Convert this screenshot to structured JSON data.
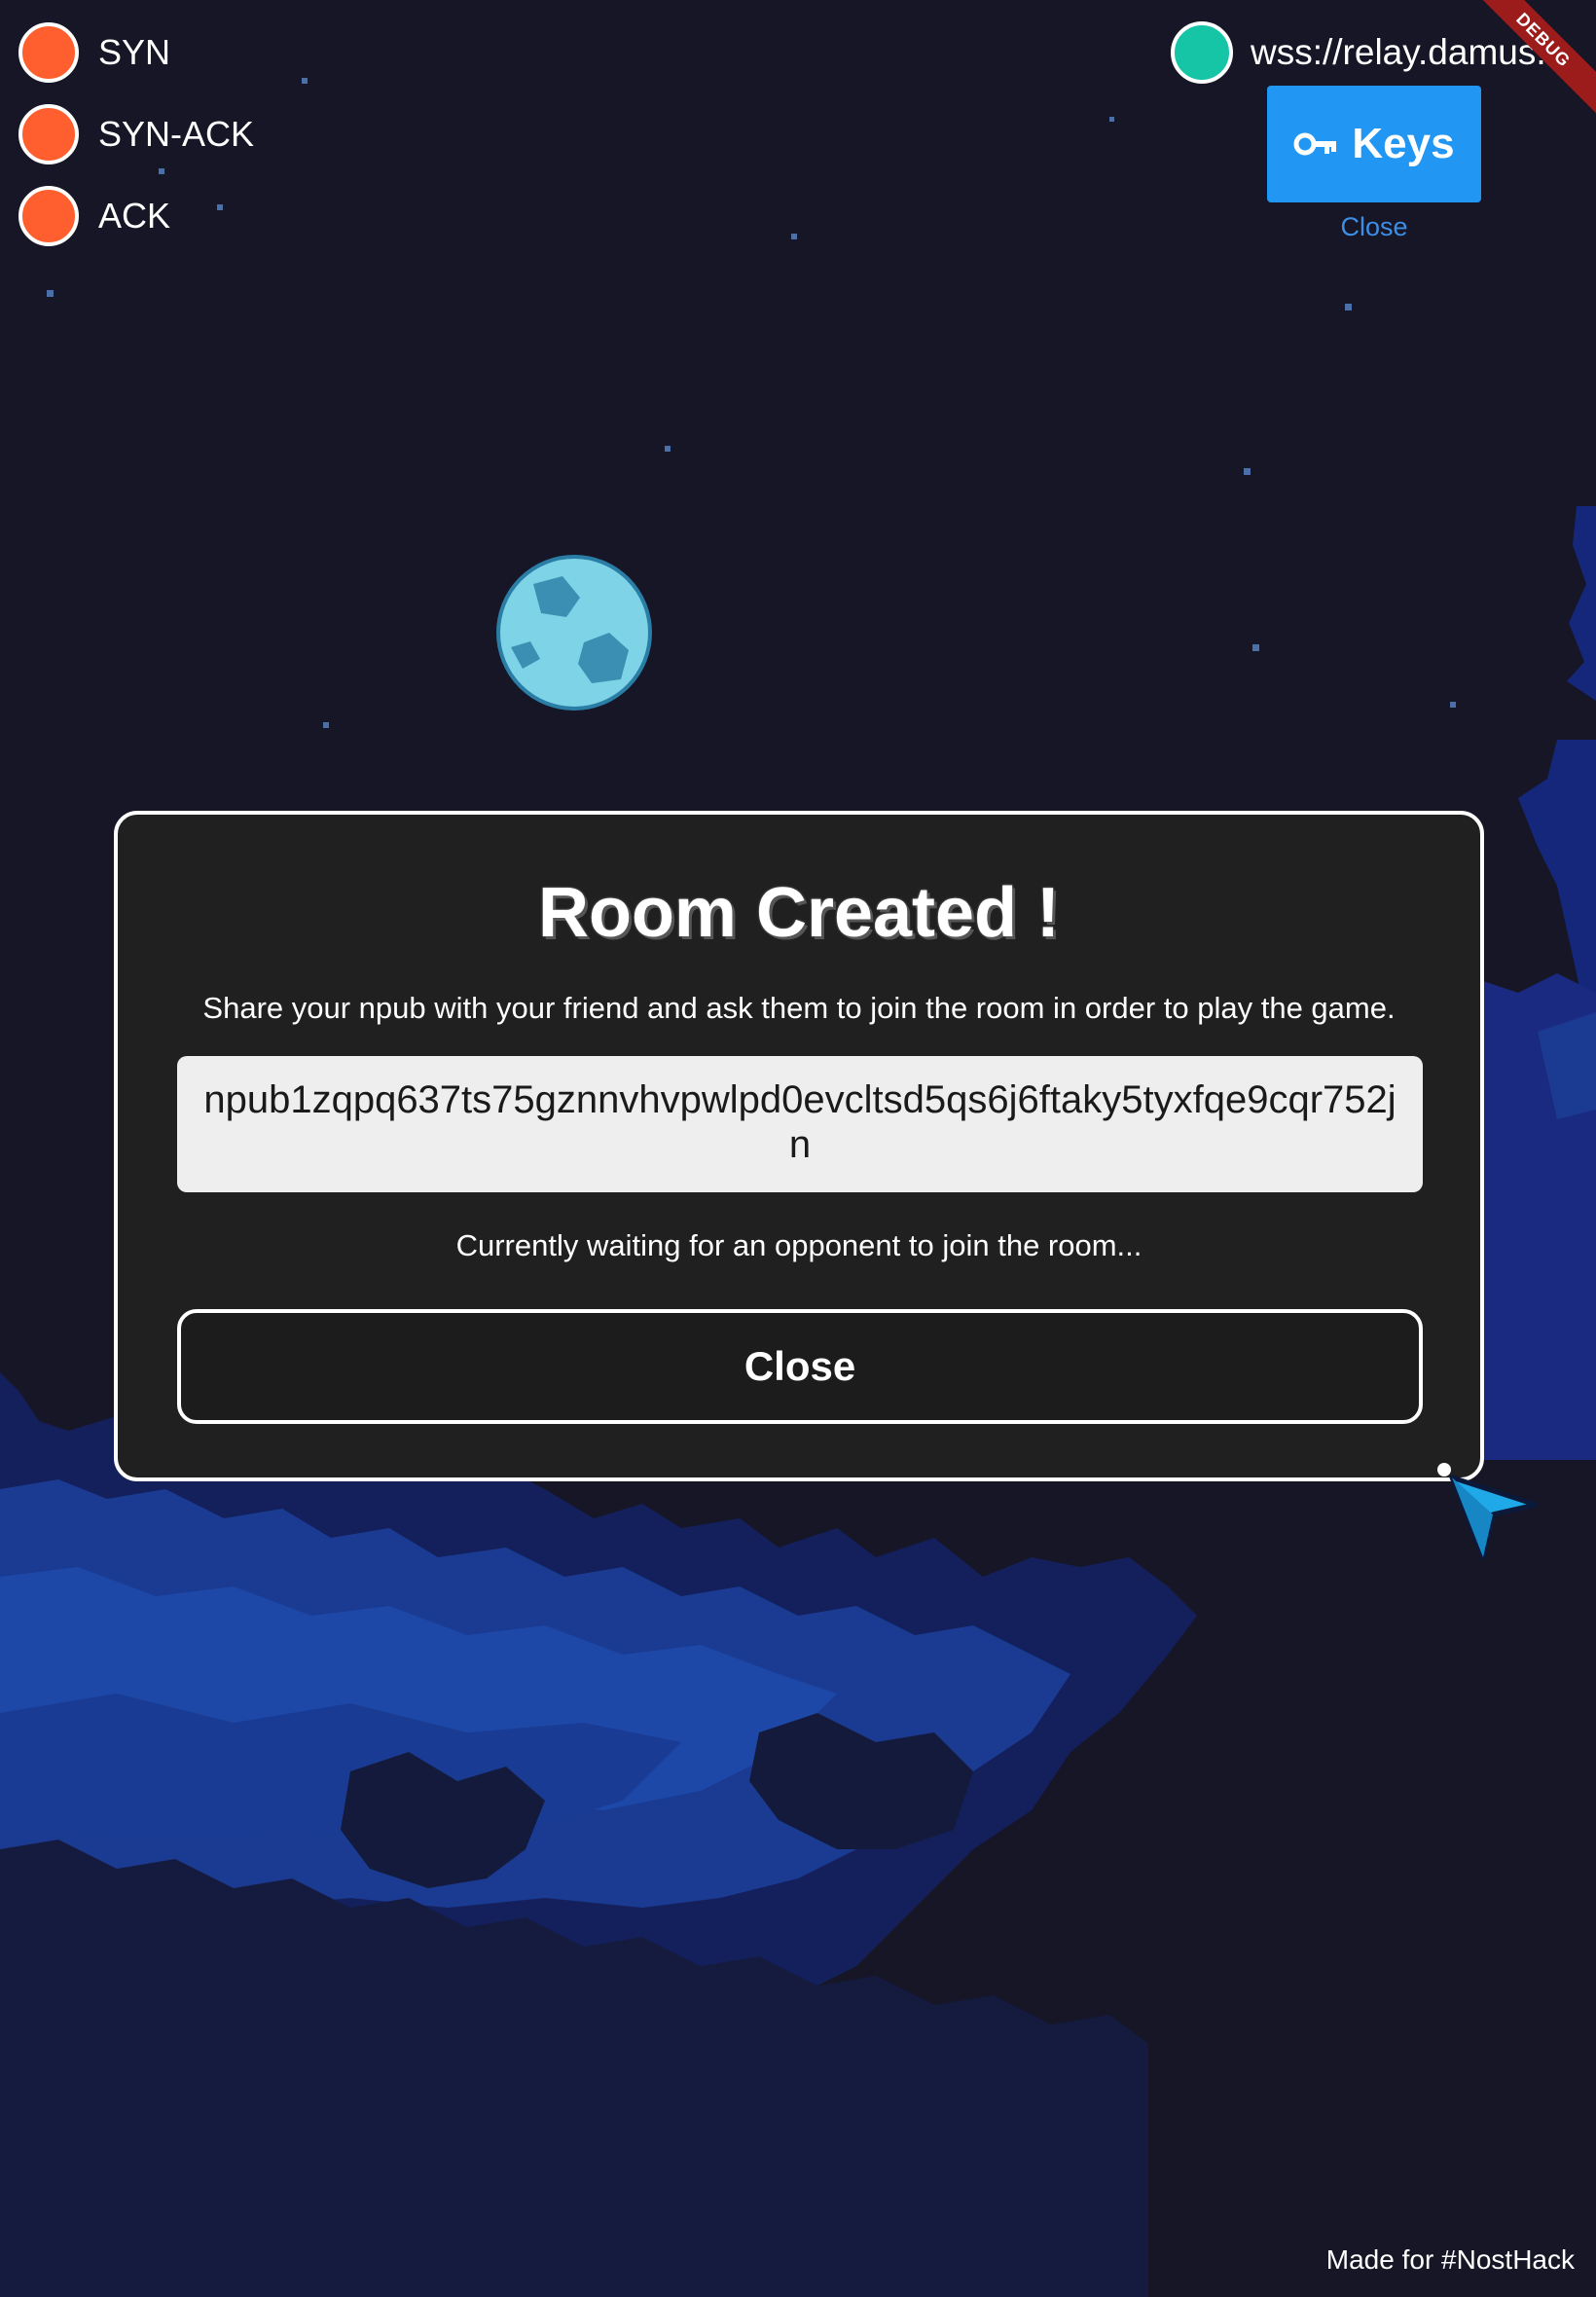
{
  "status_indicators": {
    "items": [
      {
        "label": "SYN",
        "color": "#ff5f2e"
      },
      {
        "label": "SYN-ACK",
        "color": "#ff5f2e"
      },
      {
        "label": "ACK",
        "color": "#ff5f2e"
      }
    ]
  },
  "relay": {
    "url": "wss://relay.damus.io",
    "status_color": "#16c4a6"
  },
  "keys_panel": {
    "button_label": "Keys",
    "button_icon": "key-icon",
    "close_label": "Close",
    "accent_color": "#2196f3"
  },
  "debug_banner": {
    "label": "DEBUG"
  },
  "dialog": {
    "title": "Room Created !",
    "instructions": "Share your npub with your friend and ask them to join the room in order to play the game.",
    "npub": "npub1zqpq637ts75gznnvhvpwlpd0evcltsd5qs6j6ftaky5tyxfqe9cqr752jn",
    "waiting_text": "Currently waiting for an opponent to join the room...",
    "close_label": "Close"
  },
  "footer": {
    "credit": "Made for #NostHack"
  },
  "colors": {
    "background": "#161627",
    "cloud_dark": "#15205a",
    "cloud_mid": "#1b3a91",
    "planet": "#7fd3e6"
  }
}
